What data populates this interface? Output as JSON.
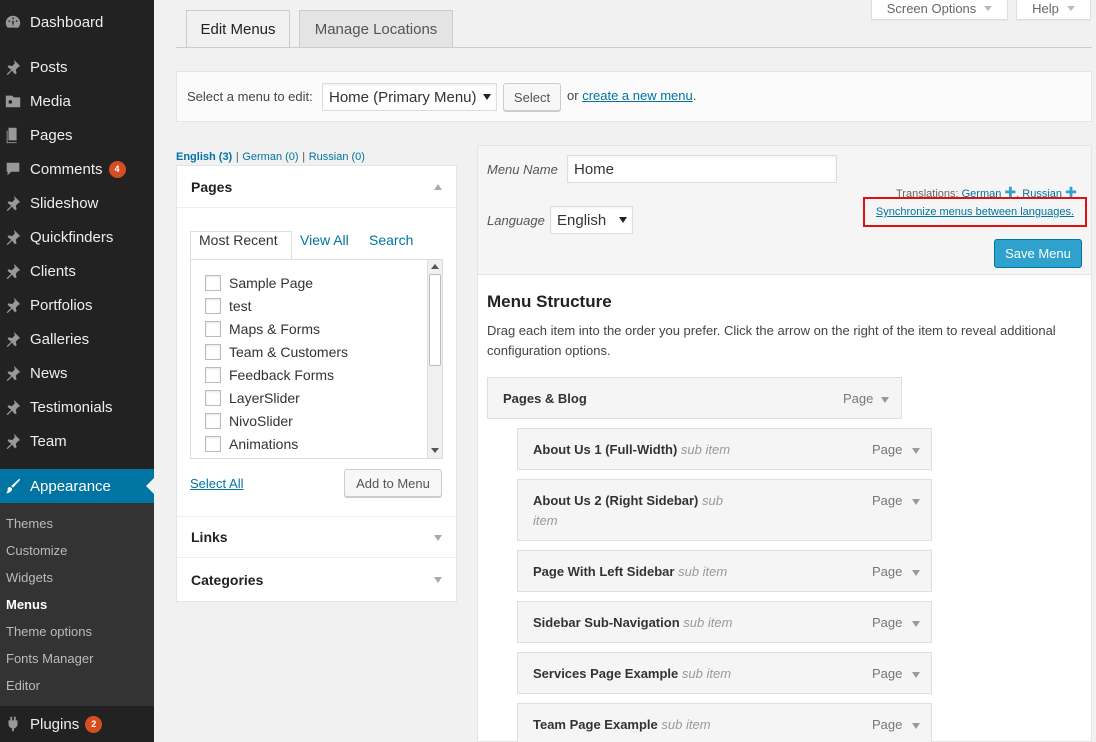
{
  "sidebar": {
    "items": [
      {
        "label": "Dashboard",
        "icon": "dashboard-icon"
      },
      {
        "label": "Posts",
        "icon": "pin-icon"
      },
      {
        "label": "Media",
        "icon": "media-icon"
      },
      {
        "label": "Pages",
        "icon": "pages-icon"
      },
      {
        "label": "Comments",
        "icon": "comment-icon",
        "badge": "4"
      },
      {
        "label": "Slideshow",
        "icon": "pin-icon"
      },
      {
        "label": "Quickfinders",
        "icon": "pin-icon"
      },
      {
        "label": "Clients",
        "icon": "pin-icon"
      },
      {
        "label": "Portfolios",
        "icon": "pin-icon"
      },
      {
        "label": "Galleries",
        "icon": "pin-icon"
      },
      {
        "label": "News",
        "icon": "pin-icon"
      },
      {
        "label": "Testimonials",
        "icon": "pin-icon"
      },
      {
        "label": "Team",
        "icon": "pin-icon"
      },
      {
        "label": "Appearance",
        "icon": "brush-icon"
      },
      {
        "label": "Plugins",
        "icon": "plug-icon",
        "badge": "2"
      }
    ],
    "submenu": [
      "Themes",
      "Customize",
      "Widgets",
      "Menus",
      "Theme options",
      "Fonts Manager",
      "Editor"
    ],
    "current_sub": "Menus"
  },
  "topbar": {
    "screen_options": "Screen Options",
    "help": "Help"
  },
  "tabs": {
    "edit": "Edit Menus",
    "manage": "Manage Locations"
  },
  "select_bar": {
    "label": "Select a menu to edit:",
    "selected": "Home (Primary Menu)",
    "button": "Select",
    "or": "or",
    "create_link": "create a new menu",
    "period": "."
  },
  "languages": {
    "links": [
      "English (3)",
      "German (0)",
      "Russian (0)"
    ],
    "sep": "|"
  },
  "pages_box": {
    "title": "Pages",
    "tabs": [
      "Most Recent",
      "View All",
      "Search"
    ],
    "items": [
      "Sample Page",
      "test",
      "Maps & Forms",
      "Team & Customers",
      "Feedback Forms",
      "LayerSlider",
      "NivoSlider",
      "Animations"
    ],
    "select_all": "Select All",
    "add_button": "Add to Menu"
  },
  "links_box": {
    "title": "Links"
  },
  "categories_box": {
    "title": "Categories"
  },
  "menu_header": {
    "name_label": "Menu Name",
    "name_value": "Home",
    "language_label": "Language",
    "language_value": "English",
    "translations_label": "Translations:",
    "translation_german": "German",
    "translation_russian": "Russian",
    "translation_sep": ",",
    "sync_link": "Synchronize menus between languages.",
    "save_button": "Save Menu"
  },
  "menu_structure": {
    "title": "Menu Structure",
    "description": "Drag each item into the order you prefer. Click the arrow on the right of the item to reveal additional configuration options.",
    "items": [
      {
        "title": "Pages & Blog",
        "sub": "",
        "type": "Page"
      },
      {
        "title": "About Us 1 (Full-Width)",
        "sub": "sub item",
        "type": "Page"
      },
      {
        "title": "About Us 2 (Right Sidebar)",
        "sub": "sub",
        "sub2": "item",
        "type": "Page"
      },
      {
        "title": "Page With Left Sidebar",
        "sub": "sub item",
        "type": "Page"
      },
      {
        "title": "Sidebar Sub-Navigation",
        "sub": "sub item",
        "type": "Page"
      },
      {
        "title": "Services Page Example",
        "sub": "sub item",
        "type": "Page"
      },
      {
        "title": "Team Page Example",
        "sub": "sub item",
        "type": "Page"
      }
    ]
  },
  "colors": {
    "accent": "#0074a2",
    "sidebar": "#222222",
    "save_button": "#2ea2cc",
    "highlight_border": "#dd1111",
    "badge": "#d54e21"
  }
}
